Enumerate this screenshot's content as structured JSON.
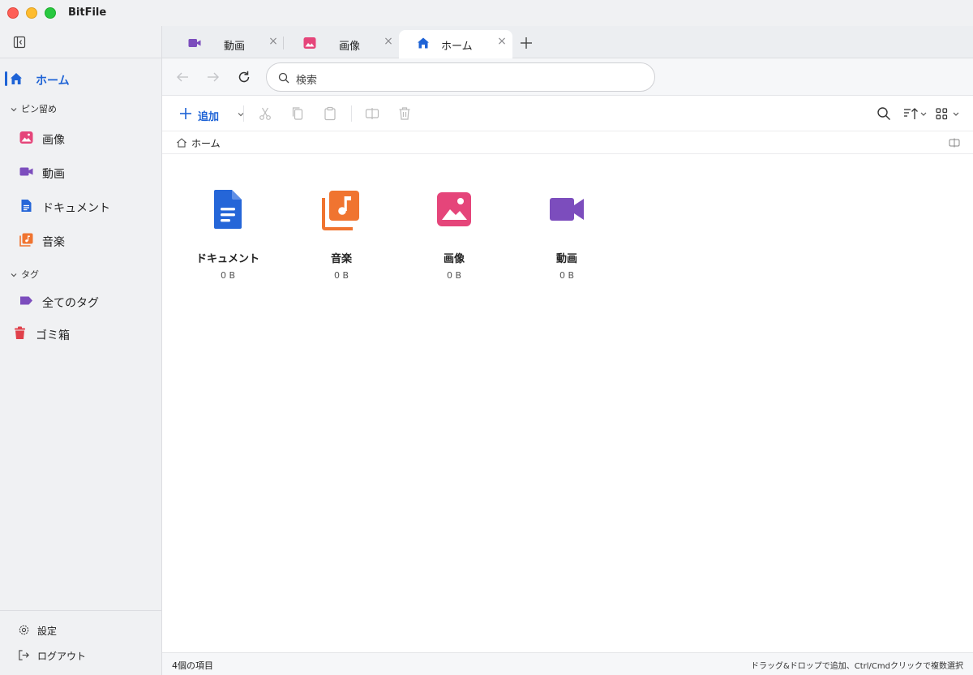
{
  "window": {
    "title": "BitFile"
  },
  "sidebar": {
    "home_label": "ホーム",
    "pinned_section": "ピン留め",
    "pinned_items": [
      {
        "label": "画像",
        "icon": "image-icon",
        "color": "#e5457a"
      },
      {
        "label": "動画",
        "icon": "video-icon",
        "color": "#7c4dbd"
      },
      {
        "label": "ドキュメント",
        "icon": "document-icon",
        "color": "#2566d8"
      },
      {
        "label": "音楽",
        "icon": "music-icon",
        "color": "#f07430"
      }
    ],
    "tags_section": "タグ",
    "all_tags_label": "全てのタグ",
    "trash_label": "ゴミ箱",
    "settings_label": "設定",
    "logout_label": "ログアウト"
  },
  "tabs": [
    {
      "label": "動画",
      "icon": "video-icon",
      "active": false
    },
    {
      "label": "画像",
      "icon": "image-icon",
      "active": false
    },
    {
      "label": "ホーム",
      "icon": "home-icon",
      "active": true
    }
  ],
  "search": {
    "placeholder": "検索"
  },
  "toolbar": {
    "add_label": "追加"
  },
  "breadcrumb": {
    "label": "ホーム"
  },
  "items": [
    {
      "name": "ドキュメント",
      "size": "0 B",
      "icon": "document-icon",
      "color": "#2566d8"
    },
    {
      "name": "音楽",
      "size": "0 B",
      "icon": "music-icon",
      "color": "#f07430"
    },
    {
      "name": "画像",
      "size": "0 B",
      "icon": "image-icon",
      "color": "#e5457a"
    },
    {
      "name": "動画",
      "size": "0 B",
      "icon": "video-icon",
      "color": "#7c4dbd"
    }
  ],
  "status": {
    "count_text": "4個の項目",
    "hint_text": "ドラッグ&ドロップで追加、Ctrl/Cmdクリックで複数選択"
  },
  "colors": {
    "accent": "#1e63d6",
    "trash": "#e0404a"
  }
}
